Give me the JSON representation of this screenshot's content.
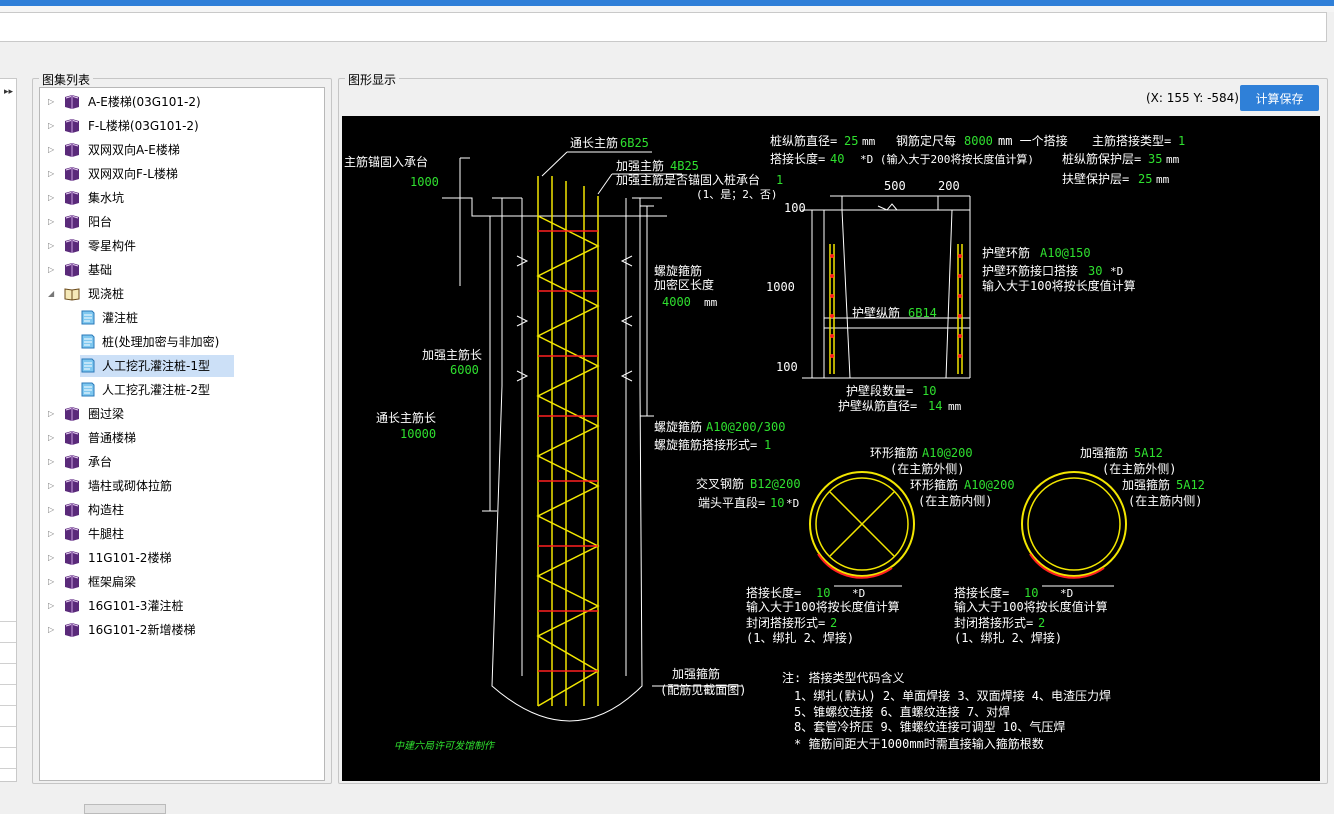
{
  "window": {
    "accent": "#2f7fd8"
  },
  "tree_panel": {
    "title": "图集列表",
    "items": [
      {
        "label": "A-E楼梯(03G101-2)",
        "expanded": false
      },
      {
        "label": "F-L楼梯(03G101-2)",
        "expanded": false
      },
      {
        "label": "双网双向A-E楼梯",
        "expanded": false
      },
      {
        "label": "双网双向F-L楼梯",
        "expanded": false
      },
      {
        "label": "集水坑",
        "expanded": false
      },
      {
        "label": "阳台",
        "expanded": false
      },
      {
        "label": "零星构件",
        "expanded": false
      },
      {
        "label": "基础",
        "expanded": false
      },
      {
        "label": "现浇桩",
        "expanded": true
      },
      {
        "label": "灌注桩",
        "child": true
      },
      {
        "label": "桩(处理加密与非加密)",
        "child": true
      },
      {
        "label": "人工挖孔灌注桩-1型",
        "child": true,
        "selected": true
      },
      {
        "label": "人工挖孔灌注桩-2型",
        "child": true
      },
      {
        "label": "圈过梁",
        "expanded": false
      },
      {
        "label": "普通楼梯",
        "expanded": false
      },
      {
        "label": "承台",
        "expanded": false
      },
      {
        "label": "墙柱或砌体拉筋",
        "expanded": false
      },
      {
        "label": "构造柱",
        "expanded": false
      },
      {
        "label": "牛腿柱",
        "expanded": false
      },
      {
        "label": "11G101-2楼梯",
        "expanded": false
      },
      {
        "label": "框架扁梁",
        "expanded": false
      },
      {
        "label": "16G101-3灌注桩",
        "expanded": false
      },
      {
        "label": "16G101-2新增楼梯",
        "expanded": false
      }
    ]
  },
  "graphic_panel": {
    "title": "图形显示",
    "coords": "(X: 155 Y: -584)",
    "calc_save_label": "计算保存"
  },
  "drawing": {
    "colors": {
      "white": "#ffffff",
      "green": "#2fe02f",
      "yellow": "#f2e600",
      "red": "#ff2020"
    },
    "left": {
      "main_anchor_label": "主筋锚固入承台",
      "main_anchor_value": "1000",
      "through_main_label": "通长主筋",
      "through_main_value": "6B25",
      "reinforce_main_label": "加强主筋",
      "reinforce_main_value": "4B25",
      "reinforce_anchor_label": "加强主筋是否锚固入桩承台",
      "reinforce_anchor_value": "1",
      "reinforce_anchor_options": "(1、是；2、否)",
      "spiral_dense_label_1": "螺旋箍筋",
      "spiral_dense_label_2": "加密区长度",
      "spiral_dense_value": "4000",
      "spiral_dense_unit": "mm",
      "reinforce_len_label": "加强主筋长",
      "reinforce_len_value": "6000",
      "through_len_label": "通长主筋长",
      "through_len_value": "10000",
      "spiral_label": "螺旋箍筋",
      "spiral_value": "A10@200/300",
      "spiral_lap_label": "螺旋箍筋搭接形式=",
      "spiral_lap_value": "1",
      "hoop_label": "加强箍筋",
      "hoop_note": "(配筋见截面图)",
      "credit": "中建六局许可发馆制作"
    },
    "top_info": {
      "bar_dia_label": "桩纵筋直径=",
      "bar_dia_value": "25",
      "unit_mm": "mm",
      "bar_fix_label": "钢筋定尺每",
      "bar_fix_value": "8000",
      "bar_fix_suffix": "mm 一个搭接",
      "lap_type_label": "主筋搭接类型=",
      "lap_type_value": "1",
      "lap_len_label": "搭接长度=",
      "lap_len_value": "40",
      "lap_len_suffix": "*D (输入大于200将按长度值计算)",
      "cover_label": "桩纵筋保护层=",
      "cover_value": "35",
      "wall_cover_label": "扶壁保护层=",
      "wall_cover_value": "25"
    },
    "wall_section": {
      "dim_500": "500",
      "dim_200": "200",
      "dim_100_top": "100",
      "dim_1000": "1000",
      "dim_100_bottom": "100",
      "ring_label": "护壁环筋",
      "ring_value": "A10@150",
      "ring_lap_label": "护壁环筋接口搭接",
      "ring_lap_value": "30",
      "ring_lap_unit": "*D",
      "ring_lap_note": "输入大于100将按长度值计算",
      "long_bar_label": "护壁纵筋",
      "long_bar_value": "6B14",
      "seg_count_label": "护壁段数量=",
      "seg_count_value": "10",
      "long_dia_label": "护壁纵筋直径=",
      "long_dia_value": "14",
      "long_dia_unit": "mm"
    },
    "circle_left": {
      "ring_label": "环形箍筋",
      "ring_value": "A10@200",
      "ring_note": "(在主筋外侧)",
      "cross_label": "交叉钢筋",
      "cross_value": "B12@200",
      "end_label": "端头平直段=",
      "end_value": "10",
      "end_unit": "*D",
      "ring2_label": "环形箍筋",
      "ring2_value": "A10@200",
      "ring2_note": "(在主筋内侧)",
      "lap_label": "搭接长度=",
      "lap_value": "10",
      "lap_unit": "*D",
      "lap_note": "输入大于100将按长度值计算",
      "close_label": "封闭搭接形式=",
      "close_value": "2",
      "close_options": "(1、绑扎  2、焊接)"
    },
    "circle_right": {
      "hoop_label": "加强箍筋",
      "hoop_value": "5A12",
      "hoop_note": "(在主筋外侧)",
      "hoop2_label": "加强箍筋",
      "hoop2_value": "5A12",
      "hoop2_note": "(在主筋内侧)",
      "lap_label": "搭接长度=",
      "lap_value": "10",
      "lap_unit": "*D",
      "lap_note": "输入大于100将按长度值计算",
      "close_label": "封闭搭接形式=",
      "close_value": "2",
      "close_options": "(1、绑扎  2、焊接)"
    },
    "notes": {
      "title": "注: 搭接类型代码含义",
      "line1": "1、绑扎(默认)   2、单面焊接   3、双面焊接   4、电渣压力焊",
      "line2": "5、锥螺纹连接   6、直螺纹连接   7、对焊",
      "line3": "8、套管冷挤压   9、锥螺纹连接可调型   10、气压焊",
      "line4": "* 箍筋间距大于1000mm时需直接输入箍筋根数"
    }
  }
}
